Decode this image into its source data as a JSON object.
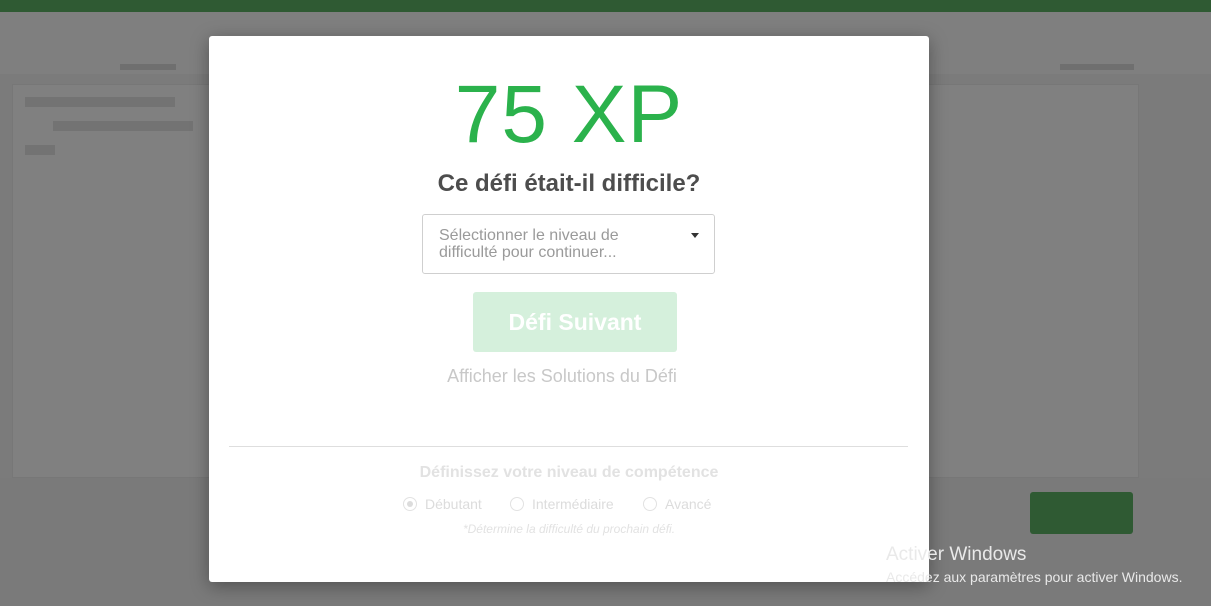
{
  "modal": {
    "xp_label": "75 XP",
    "question": "Ce défi était-il difficile?",
    "difficulty_select": {
      "placeholder": "Sélectionner le niveau de difficulté pour continuer..."
    },
    "next_button": "Défi Suivant",
    "solutions_link": "Afficher les Solutions du Défi",
    "skill": {
      "title": "Définissez votre niveau de compétence",
      "options": [
        {
          "label": "Débutant",
          "selected": true
        },
        {
          "label": "Intermédiaire",
          "selected": false
        },
        {
          "label": "Avancé",
          "selected": false
        }
      ],
      "note": "*Détermine la difficulté du prochain défi."
    },
    "colors": {
      "xp": "#2bb24c",
      "button_disabled_bg": "#d5f0dc",
      "header_bar": "#2f5a33"
    }
  },
  "windows_watermark": {
    "title": "Activer Windows",
    "subtitle": "Accédez aux paramètres pour activer Windows."
  }
}
